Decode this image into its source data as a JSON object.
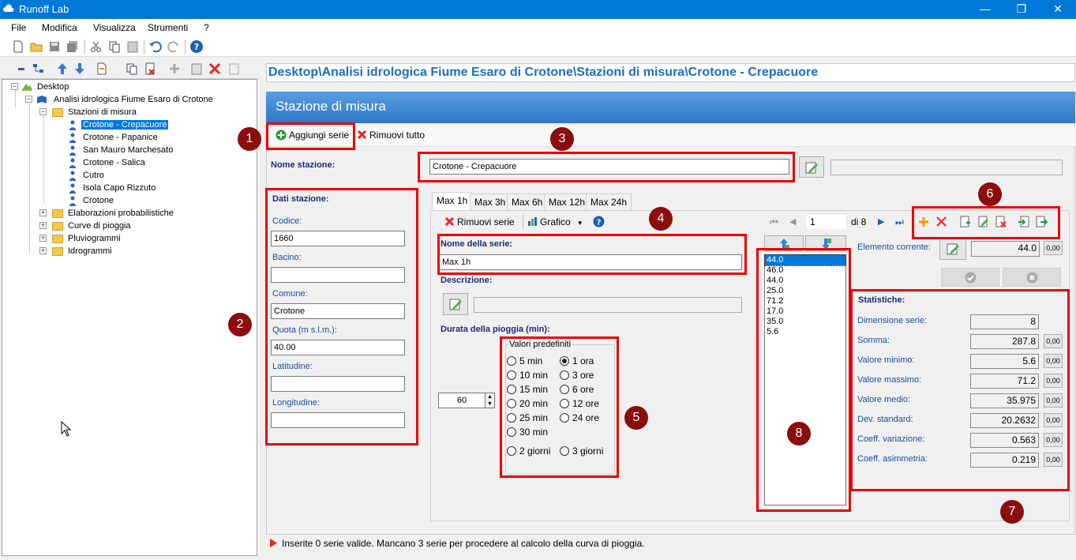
{
  "window": {
    "title": "Runoff Lab",
    "minimize": "—",
    "maximize": "❐",
    "close": "✕"
  },
  "menu": [
    "File",
    "Modifica",
    "Visualizza",
    "Strumenti",
    "?"
  ],
  "tree": {
    "root": "Desktop",
    "project": "Analisi idrologica Fiume Esaro di Crotone",
    "stations_folder": "Stazioni di misura",
    "stations": [
      "Crotone - Crepacuore",
      "Crotone - Papanice",
      "San Mauro Marchesato",
      "Crotone - Salica",
      "Cutro",
      "Isola Capo Rizzuto",
      "Crotone"
    ],
    "selected_station": "Crotone - Crepacuore",
    "folders": [
      "Elaborazioni probabilistiche",
      "Curve di pioggia",
      "Pluviogrammi",
      "Idrogrammi"
    ]
  },
  "path": "Desktop\\Analisi idrologica Fiume Esaro di Crotone\\Stazioni di misura\\Crotone - Crepacuore",
  "panel_title": "Stazione di misura",
  "actions": {
    "add_series": "Aggiungi serie",
    "remove_all": "Rimuovi tutto"
  },
  "station": {
    "name_label": "Nome stazione:",
    "name_value": "Crotone - Crepacuore",
    "data_title": "Dati stazione:",
    "fields": [
      {
        "label": "Codice:",
        "value": "1660"
      },
      {
        "label": "Bacino:",
        "value": ""
      },
      {
        "label": "Comune:",
        "value": "Crotone"
      },
      {
        "label": "Quota (m s.l.m.):",
        "value": "40.00"
      },
      {
        "label": "Latitudine:",
        "value": ""
      },
      {
        "label": "Longitudine:",
        "value": ""
      }
    ]
  },
  "tabs": [
    "Max 1h",
    "Max 3h",
    "Max 6h",
    "Max 12h",
    "Max 24h"
  ],
  "series_toolbar": {
    "remove": "Rimuovi serie",
    "chart": "Grafico"
  },
  "series": {
    "name_label": "Nome della serie:",
    "name_value": "Max 1h",
    "desc_label": "Descrizione:",
    "duration_label": "Durata della pioggia (min):",
    "duration_value": "60",
    "presets_title": "Valori predefiniti",
    "presets_left": [
      "5 min",
      "10 min",
      "15 min",
      "20 min",
      "25 min",
      "30 min"
    ],
    "presets_right": [
      "1 ora",
      "3 ore",
      "6 ore",
      "12 ore",
      "24 ore"
    ],
    "presets_bottom": [
      "2 giorni",
      "3 giorni"
    ],
    "selected_preset": "1 ora"
  },
  "navigator": {
    "page": "1",
    "of": "di 8"
  },
  "values": [
    "44.0",
    "46.0",
    "44.0",
    "25.0",
    "71.2",
    "17.0",
    "35.0",
    "5.6"
  ],
  "current": {
    "label": "Elemento corrente:",
    "value": "44.0",
    "decimals": "0,00"
  },
  "stats": {
    "title": "Statistiche:",
    "rows": [
      {
        "label": "Dimensione serie:",
        "value": "8",
        "dec": ""
      },
      {
        "label": "Somma:",
        "value": "287.8",
        "dec": "0,00"
      },
      {
        "label": "Valore minimo:",
        "value": "5.6",
        "dec": "0,00"
      },
      {
        "label": "Valore massimo:",
        "value": "71.2",
        "dec": "0,00"
      },
      {
        "label": "Valore medio:",
        "value": "35.975",
        "dec": "0,00"
      },
      {
        "label": "Dev. standard:",
        "value": "20.2632",
        "dec": "0,00"
      },
      {
        "label": "Coeff. variazione:",
        "value": "0.563",
        "dec": "0,00"
      },
      {
        "label": "Coeff. asimmetria:",
        "value": "0.219",
        "dec": "0,00"
      }
    ]
  },
  "badges": [
    "1",
    "2",
    "3",
    "4",
    "5",
    "6",
    "7",
    "8"
  ],
  "status": "Inserite 0 serie valide. Mancano 3 serie per procedere al calcolo della curva di pioggia.",
  "colors": {
    "accent": "#0078d7",
    "highlight": "#e00000",
    "badge": "#8b0d0d",
    "path": "#1c6fc3"
  }
}
